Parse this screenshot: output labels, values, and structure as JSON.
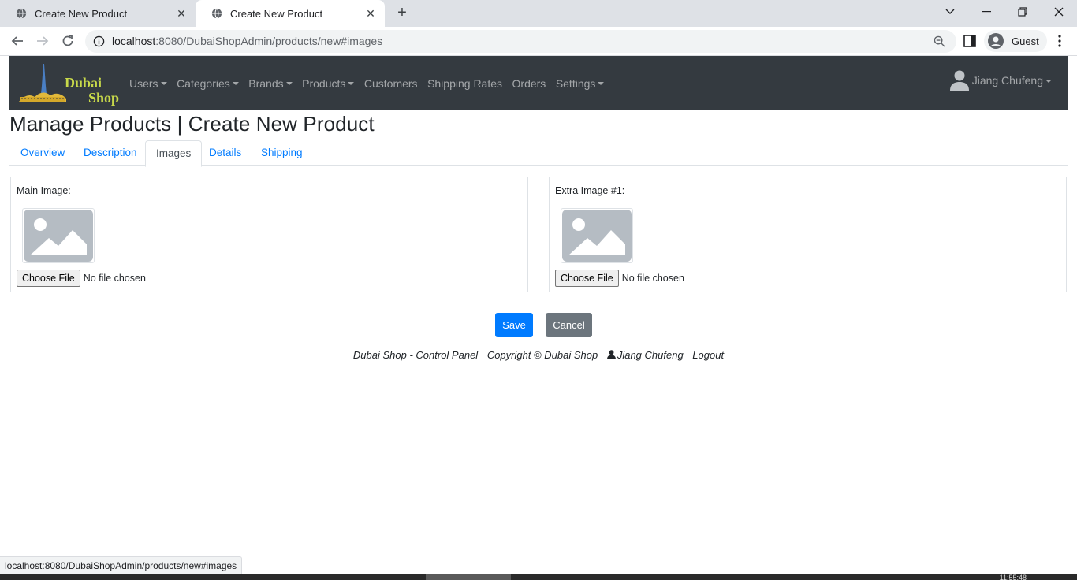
{
  "browser": {
    "tabs": [
      {
        "title": "Create New Product"
      },
      {
        "title": "Create New Product"
      }
    ],
    "address": {
      "host": "localhost",
      "rest": ":8080/DubaiShopAdmin/products/new#images"
    },
    "profile_label": "Guest",
    "status_url": "localhost:8080/DubaiShopAdmin/products/new#images",
    "clock": "11:55:48"
  },
  "brand": {
    "line1": "Dubai",
    "line2": "Shop"
  },
  "navbar": {
    "items": [
      {
        "label": "Users",
        "dropdown": true
      },
      {
        "label": "Categories",
        "dropdown": true
      },
      {
        "label": "Brands",
        "dropdown": true
      },
      {
        "label": "Products",
        "dropdown": true
      },
      {
        "label": "Customers",
        "dropdown": false
      },
      {
        "label": "Shipping Rates",
        "dropdown": false
      },
      {
        "label": "Orders",
        "dropdown": false
      },
      {
        "label": "Settings",
        "dropdown": true
      }
    ],
    "user": "Jiang Chufeng"
  },
  "page": {
    "title": "Manage Products | Create New Product",
    "tabs": [
      "Overview",
      "Description",
      "Images",
      "Details",
      "Shipping"
    ],
    "active_tab": "Images"
  },
  "images": {
    "main": {
      "label": "Main Image:",
      "button": "Choose File",
      "status": "No file chosen"
    },
    "extra": {
      "label": "Extra Image #1:",
      "button": "Choose File",
      "status": "No file chosen"
    }
  },
  "actions": {
    "save": "Save",
    "cancel": "Cancel"
  },
  "footer": {
    "panel": "Dubai Shop - Control Panel",
    "copyright": "Copyright © Dubai Shop",
    "user": "Jiang Chufeng",
    "logout": "Logout"
  },
  "colors": {
    "navbar_bg": "#343a40",
    "primary": "#007bff",
    "secondary": "#6c757d",
    "logo_text": "#c8d94a"
  }
}
